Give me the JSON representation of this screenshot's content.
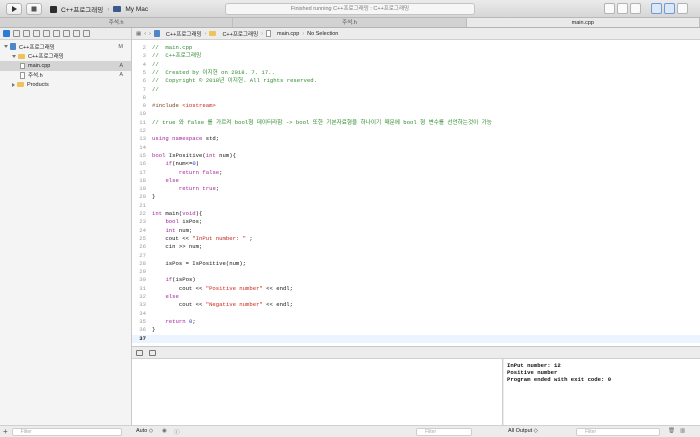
{
  "toolbar": {
    "scheme_target": "C++프로그래밍",
    "scheme_device": "My Mac",
    "status": "Finished running C++프로그래밍 : C++프로그래밍"
  },
  "tabs": [
    {
      "label": "주석.h",
      "active": false
    },
    {
      "label": "주석.h",
      "active": false
    },
    {
      "label": "main.cpp",
      "active": true
    }
  ],
  "navigator": {
    "items": [
      {
        "label": "C++프로그래밍",
        "badge": "M",
        "kind": "project",
        "indent": 1,
        "expanded": true,
        "selected": false
      },
      {
        "label": "C++프로그래밍",
        "badge": "",
        "kind": "folder",
        "indent": 2,
        "expanded": true,
        "selected": false
      },
      {
        "label": "main.cpp",
        "badge": "A",
        "kind": "file",
        "indent": 3,
        "expanded": false,
        "selected": true
      },
      {
        "label": "주석.h",
        "badge": "A",
        "kind": "file",
        "indent": 3,
        "expanded": false,
        "selected": false
      },
      {
        "label": "Products",
        "badge": "",
        "kind": "folder",
        "indent": 2,
        "expanded": false,
        "selected": false
      }
    ],
    "filter_placeholder": "Filter"
  },
  "jumpbar": {
    "project": "C++프로그래밍",
    "folder": "C++프로그래밍",
    "file": "main.cpp",
    "selection": "No Selection"
  },
  "editor": {
    "current_line": "37",
    "lines": [
      {
        "n": "2",
        "t": [
          [
            "cm",
            "//  main.cpp"
          ]
        ]
      },
      {
        "n": "3",
        "t": [
          [
            "cm",
            "//  C++프로그래밍"
          ]
        ]
      },
      {
        "n": "4",
        "t": [
          [
            "cm",
            "//"
          ]
        ]
      },
      {
        "n": "5",
        "t": [
          [
            "cm",
            "//  Created by 이지헌 on 2018. 7. 17.."
          ]
        ]
      },
      {
        "n": "6",
        "t": [
          [
            "cm",
            "//  Copyright © 2018년 이지헌. All rights reserved."
          ]
        ]
      },
      {
        "n": "7",
        "t": [
          [
            "cm",
            "//"
          ]
        ]
      },
      {
        "n": "8",
        "t": []
      },
      {
        "n": "9",
        "t": [
          [
            "pp",
            "#include "
          ],
          [
            "st",
            "<iostream>"
          ]
        ]
      },
      {
        "n": "10",
        "t": []
      },
      {
        "n": "11",
        "t": [
          [
            "cm",
            "// true 와 false 를 가르켜 bool형 데이터라함 -> bool 또한 기본자료형을 하나이기 때문에 bool 형 변수를 선언하는것이 가능"
          ]
        ]
      },
      {
        "n": "12",
        "t": []
      },
      {
        "n": "13",
        "t": [
          [
            "kw",
            "using namespace"
          ],
          [
            "tx",
            " std;"
          ]
        ]
      },
      {
        "n": "14",
        "t": []
      },
      {
        "n": "15",
        "t": [
          [
            "kw",
            "bool"
          ],
          [
            "tx",
            " IsPositive("
          ],
          [
            "kw",
            "int"
          ],
          [
            "tx",
            " num){"
          ]
        ]
      },
      {
        "n": "16",
        "t": [
          [
            "tx",
            "    "
          ],
          [
            "kw",
            "if"
          ],
          [
            "tx",
            "(num<="
          ],
          [
            "nm",
            "0"
          ],
          [
            "tx",
            ")"
          ]
        ]
      },
      {
        "n": "17",
        "t": [
          [
            "tx",
            "        "
          ],
          [
            "kw",
            "return"
          ],
          [
            "tx",
            " "
          ],
          [
            "kw",
            "false"
          ],
          [
            "tx",
            ";"
          ]
        ]
      },
      {
        "n": "18",
        "t": [
          [
            "tx",
            "    "
          ],
          [
            "kw",
            "else"
          ]
        ]
      },
      {
        "n": "19",
        "t": [
          [
            "tx",
            "        "
          ],
          [
            "kw",
            "return"
          ],
          [
            "tx",
            " "
          ],
          [
            "kw",
            "true"
          ],
          [
            "tx",
            ";"
          ]
        ]
      },
      {
        "n": "20",
        "t": [
          [
            "tx",
            "}"
          ]
        ]
      },
      {
        "n": "21",
        "t": []
      },
      {
        "n": "22",
        "t": [
          [
            "kw",
            "int"
          ],
          [
            "tx",
            " main("
          ],
          [
            "kw",
            "void"
          ],
          [
            "tx",
            "){"
          ]
        ]
      },
      {
        "n": "23",
        "t": [
          [
            "tx",
            "    "
          ],
          [
            "kw",
            "bool"
          ],
          [
            "tx",
            " isPos;"
          ]
        ]
      },
      {
        "n": "24",
        "t": [
          [
            "tx",
            "    "
          ],
          [
            "kw",
            "int"
          ],
          [
            "tx",
            " num;"
          ]
        ]
      },
      {
        "n": "25",
        "t": [
          [
            "tx",
            "    cout << "
          ],
          [
            "st",
            "\"InPut number: \""
          ],
          [
            "tx",
            " ;"
          ]
        ]
      },
      {
        "n": "26",
        "t": [
          [
            "tx",
            "    cin >> num;"
          ]
        ]
      },
      {
        "n": "27",
        "t": []
      },
      {
        "n": "28",
        "t": [
          [
            "tx",
            "    isPos = IsPositive(num);"
          ]
        ]
      },
      {
        "n": "29",
        "t": []
      },
      {
        "n": "30",
        "t": [
          [
            "tx",
            "    "
          ],
          [
            "kw",
            "if"
          ],
          [
            "tx",
            "(isPos)"
          ]
        ]
      },
      {
        "n": "31",
        "t": [
          [
            "tx",
            "        cout << "
          ],
          [
            "st",
            "\"Positive number\""
          ],
          [
            "tx",
            " << endl;"
          ]
        ]
      },
      {
        "n": "32",
        "t": [
          [
            "tx",
            "    "
          ],
          [
            "kw",
            "else"
          ]
        ]
      },
      {
        "n": "33",
        "t": [
          [
            "tx",
            "        cout << "
          ],
          [
            "st",
            "\"Negative number\""
          ],
          [
            "tx",
            " << endl;"
          ]
        ]
      },
      {
        "n": "34",
        "t": []
      },
      {
        "n": "35",
        "t": [
          [
            "tx",
            "    "
          ],
          [
            "kw",
            "return"
          ],
          [
            "tx",
            " "
          ],
          [
            "nm",
            "0"
          ],
          [
            "tx",
            ";"
          ]
        ]
      },
      {
        "n": "36",
        "t": [
          [
            "tx",
            "}"
          ]
        ]
      },
      {
        "n": "37",
        "t": []
      }
    ]
  },
  "debug": {
    "auto_label": "Auto ◇",
    "vars_filter_placeholder": "Filter",
    "output_label": "All Output ◇",
    "console_filter_placeholder": "Filter",
    "console_lines": [
      "InPut number: 12",
      "Positive number",
      "Program ended with exit code: 0"
    ]
  },
  "colors": {
    "comment": "#2e8a2e",
    "keyword": "#a4249e",
    "string": "#c4271c",
    "number": "#2a34c8",
    "accent": "#2a7bd7"
  }
}
